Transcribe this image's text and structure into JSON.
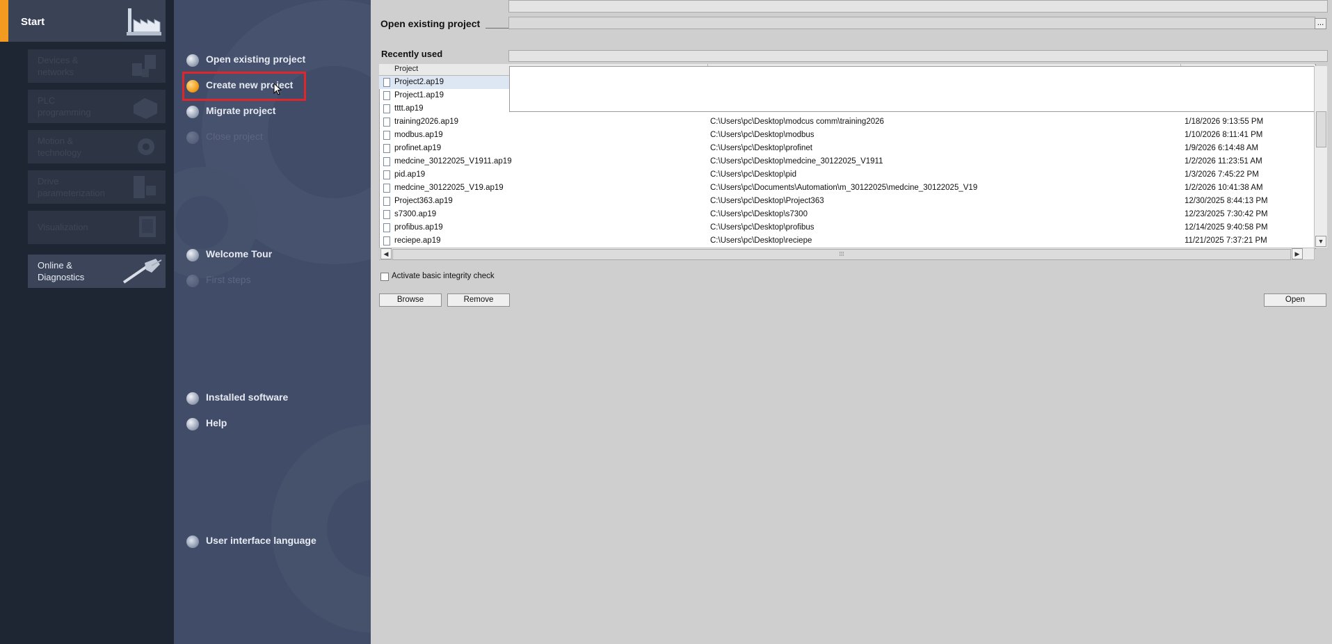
{
  "portal": {
    "start_label": "Start",
    "buttons": [
      {
        "label": "Devices &\nnetworks",
        "icon": "devices-networks-icon"
      },
      {
        "label": "PLC\nprogramming",
        "icon": "plc-programming-icon"
      },
      {
        "label": "Motion &\ntechnology",
        "icon": "motion-gear-icon"
      },
      {
        "label": "Drive\nparameterization",
        "icon": "drive-icon"
      },
      {
        "label": "Visualization",
        "icon": "visualization-icon"
      },
      {
        "label": "Online &\nDiagnostics",
        "icon": "online-diagnostics-icon"
      }
    ]
  },
  "actions": {
    "open_existing": "Open existing project",
    "create_new": "Create new project",
    "migrate": "Migrate project",
    "close": "Close project",
    "welcome_tour": "Welcome Tour",
    "first_steps": "First steps",
    "installed_software": "Installed software",
    "help": "Help",
    "ui_language": "User interface language"
  },
  "content": {
    "open_existing_title": "Open existing project",
    "browse_dots": "...",
    "recently_used": "Recently used",
    "column_project": "Project",
    "rows": [
      {
        "name": "Project2.ap19",
        "path": "",
        "date": ""
      },
      {
        "name": "Project1.ap19",
        "path": "",
        "date": ""
      },
      {
        "name": "tttt.ap19",
        "path": "",
        "date": ""
      },
      {
        "name": "training2026.ap19",
        "path": "C:\\Users\\pc\\Desktop\\modcus comm\\training2026",
        "date": "1/18/2026 9:13:55 PM"
      },
      {
        "name": "modbus.ap19",
        "path": "C:\\Users\\pc\\Desktop\\modbus",
        "date": "1/10/2026 8:11:41 PM"
      },
      {
        "name": "profinet.ap19",
        "path": "C:\\Users\\pc\\Desktop\\profinet",
        "date": "1/9/2026 6:14:48 AM"
      },
      {
        "name": "medcine_30122025_V1911.ap19",
        "path": "C:\\Users\\pc\\Desktop\\medcine_30122025_V1911",
        "date": "1/2/2026 11:23:51 AM"
      },
      {
        "name": "pid.ap19",
        "path": "C:\\Users\\pc\\Desktop\\pid",
        "date": "1/3/2026 7:45:22 PM"
      },
      {
        "name": "medcine_30122025_V19.ap19",
        "path": "C:\\Users\\pc\\Documents\\Automation\\m_30122025\\medcine_30122025_V19",
        "date": "1/2/2026 10:41:38 AM"
      },
      {
        "name": "Project363.ap19",
        "path": "C:\\Users\\pc\\Desktop\\Project363",
        "date": "12/30/2025 8:44:13 PM"
      },
      {
        "name": "s7300.ap19",
        "path": "C:\\Users\\pc\\Desktop\\s7300",
        "date": "12/23/2025 7:30:42 PM"
      },
      {
        "name": "profibus.ap19",
        "path": "C:\\Users\\pc\\Desktop\\profibus",
        "date": "12/14/2025 9:40:58 PM"
      },
      {
        "name": "reciepe.ap19",
        "path": "C:\\Users\\pc\\Desktop\\reciepe",
        "date": "11/21/2025 7:37:21 PM"
      }
    ],
    "integrity_check": "Activate basic integrity check",
    "browse": "Browse",
    "remove": "Remove",
    "open": "Open",
    "scroll_up": "▲",
    "scroll_down": "▼",
    "scroll_left": "◀",
    "scroll_right": "▶",
    "scroll_grip": "⁞⁞⁞"
  },
  "colors": {
    "accent": "#f39a21",
    "highlight": "#e0262a"
  }
}
